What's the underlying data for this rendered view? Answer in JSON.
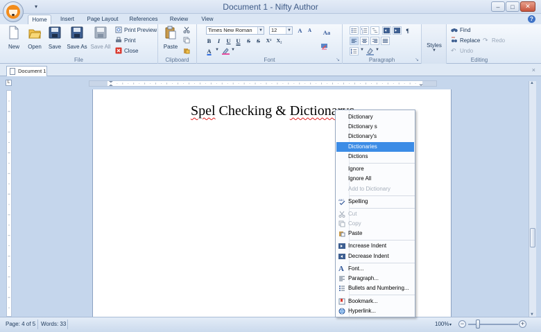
{
  "window": {
    "title": "Document 1 - Nifty Author",
    "qat_label": "▾",
    "help_label": "?"
  },
  "tabs": [
    {
      "label": "Home",
      "active": true
    },
    {
      "label": "Insert"
    },
    {
      "label": "Page Layout"
    },
    {
      "label": "References"
    },
    {
      "label": "Review"
    },
    {
      "label": "View"
    }
  ],
  "ribbon": {
    "file": {
      "label": "File",
      "new": "New",
      "open": "Open",
      "save": "Save",
      "save_as": "Save As",
      "save_all": "Save All",
      "print_preview": "Print Preview",
      "print": "Print",
      "close": "Close"
    },
    "clipboard": {
      "label": "Clipboard",
      "paste": "Paste"
    },
    "font": {
      "label": "Font",
      "family": "Times New Roman",
      "size": "12",
      "grow": "A",
      "shrink": "A",
      "case": "Aa",
      "bold": "B",
      "italic": "I",
      "underline": "U",
      "double_underline": "U",
      "strike": "S",
      "double_strike": "S",
      "superscript": "X²",
      "subscript": "X₂",
      "font_color": "A"
    },
    "paragraph": {
      "label": "Paragraph"
    },
    "styles": {
      "label": "Styles"
    },
    "editing": {
      "label": "Editing",
      "find": "Find",
      "replace": "Replace",
      "redo": "Redo",
      "undo": "Undo"
    },
    "launcher_glyph": "↘"
  },
  "document": {
    "tab_label": "Document 1",
    "tab_close": "×",
    "ruler_corner": "L",
    "heading_word1": "Spel",
    "heading_middle": " Checking & ",
    "heading_word2": "Dictionarys"
  },
  "context_menu": {
    "suggestions": [
      "Dictionary",
      "Dictionary s",
      "Dictionary's",
      "Dictionaries",
      "Dictions"
    ],
    "highlighted_index": 3,
    "ignore": "Ignore",
    "ignore_all": "Ignore All",
    "add_to_dictionary": "Add to Dictionary",
    "spelling": "Spelling",
    "cut": "Cut",
    "copy": "Copy",
    "paste": "Paste",
    "increase_indent": "Increase Indent",
    "decrease_indent": "Decrease Indent",
    "font": "Font...",
    "paragraph": "Paragraph...",
    "bullets": "Bullets and Numbering...",
    "bookmark": "Bookmark...",
    "hyperlink": "Hyperlink..."
  },
  "status": {
    "page": "Page: 4 of 5",
    "words": "Words: 33",
    "zoom": "100%",
    "zoom_arrow": "▾",
    "zoom_minus": "−",
    "zoom_plus": "+"
  },
  "colors": {
    "accent": "#3c8ce6",
    "misspelling_underline": "#e02020",
    "close_button": "#c7543d",
    "app_icon": "#f28c1c"
  },
  "icons": {
    "app": "fox-icon",
    "close": "close-icon",
    "maximize": "maximize-icon",
    "minimize": "minimize-icon",
    "help": "help-icon"
  }
}
